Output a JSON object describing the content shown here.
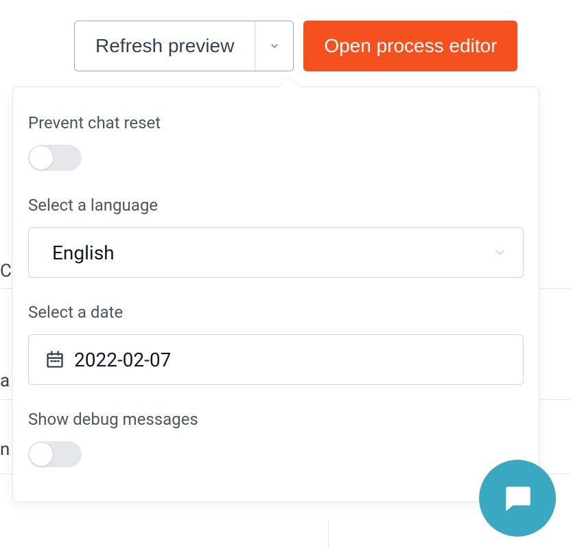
{
  "toolbar": {
    "refresh_label": "Refresh preview",
    "open_editor_label": "Open process editor"
  },
  "popover": {
    "prevent_reset_label": "Prevent chat reset",
    "prevent_reset_value": false,
    "language_label": "Select a language",
    "language_value": "English",
    "date_label": "Select a date",
    "date_value": "2022-02-07",
    "debug_label": "Show debug messages",
    "debug_value": false
  },
  "colors": {
    "primary": "#f4511e",
    "fab": "#3aa8c1"
  }
}
